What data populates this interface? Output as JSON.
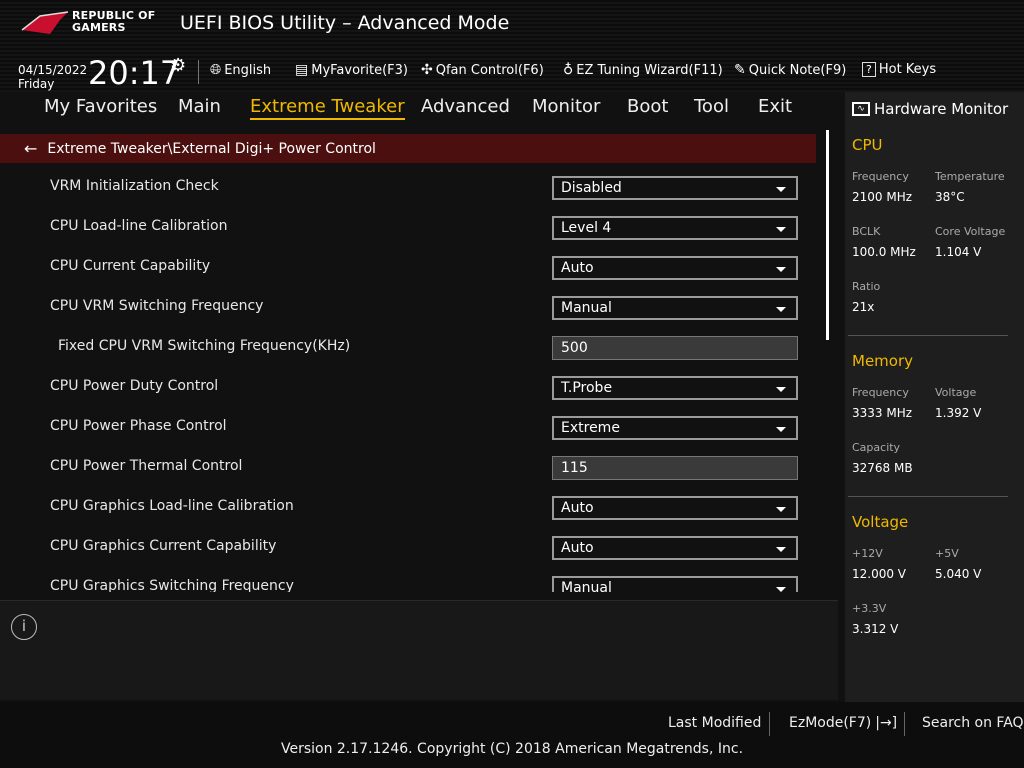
{
  "header": {
    "logo_text": [
      "REPUBLIC OF",
      "GAMERS"
    ],
    "title": "UEFI BIOS Utility – Advanced Mode",
    "date": "04/15/2022",
    "day": "Friday",
    "time": "20:17",
    "tools": [
      {
        "icon": "globe-icon",
        "label": "English"
      },
      {
        "icon": "favorite-list-icon",
        "label": "MyFavorite(F3)"
      },
      {
        "icon": "fan-icon",
        "label": "Qfan Control(F6)"
      },
      {
        "icon": "lightbulb-icon",
        "label": "EZ Tuning Wizard(F11)"
      },
      {
        "icon": "note-icon",
        "label": "Quick Note(F9)"
      },
      {
        "icon": "help-icon",
        "label": "Hot Keys"
      }
    ]
  },
  "nav": {
    "tabs": [
      "My Favorites",
      "Main",
      "Extreme Tweaker",
      "Advanced",
      "Monitor",
      "Boot",
      "Tool",
      "Exit"
    ],
    "active": "Extreme Tweaker"
  },
  "breadcrumb": "Extreme Tweaker\\External Digi+ Power Control",
  "settings": [
    {
      "label": "VRM Initialization Check",
      "value": "Disabled",
      "type": "select"
    },
    {
      "label": "CPU Load-line Calibration",
      "value": "Level 4",
      "type": "select"
    },
    {
      "label": "CPU Current Capability",
      "value": "Auto",
      "type": "select"
    },
    {
      "label": "CPU VRM Switching Frequency",
      "value": "Manual",
      "type": "select"
    },
    {
      "label": "Fixed CPU VRM Switching Frequency(KHz)",
      "value": "500",
      "type": "input"
    },
    {
      "label": "CPU Power Duty Control",
      "value": "T.Probe",
      "type": "select"
    },
    {
      "label": "CPU Power Phase Control",
      "value": "Extreme",
      "type": "select"
    },
    {
      "label": "CPU Power Thermal Control",
      "value": "115",
      "type": "input"
    },
    {
      "label": "CPU Graphics Load-line Calibration",
      "value": "Auto",
      "type": "select"
    },
    {
      "label": "CPU Graphics Current Capability",
      "value": "Auto",
      "type": "select"
    },
    {
      "label": "CPU Graphics Switching Frequency",
      "value": "Manual",
      "type": "select"
    }
  ],
  "hw": {
    "title": "Hardware Monitor",
    "cpu": {
      "title": "CPU",
      "freq_k": "Frequency",
      "freq": "2100 MHz",
      "temp_k": "Temperature",
      "temp": "38°C",
      "bclk_k": "BCLK",
      "bclk": "100.0 MHz",
      "cv_k": "Core Voltage",
      "cv": "1.104 V",
      "ratio_k": "Ratio",
      "ratio": "21x"
    },
    "mem": {
      "title": "Memory",
      "freq_k": "Frequency",
      "freq": "3333 MHz",
      "volt_k": "Voltage",
      "volt": "1.392 V",
      "cap_k": "Capacity",
      "cap": "32768 MB"
    },
    "volt": {
      "title": "Voltage",
      "v12_k": "+12V",
      "v12": "12.000 V",
      "v5_k": "+5V",
      "v5": "5.040 V",
      "v33_k": "+3.3V",
      "v33": "3.312 V"
    }
  },
  "footer": {
    "last_modified": "Last Modified",
    "ezmode": "EzMode(F7)",
    "search_faq": "Search on FAQ",
    "version": "Version 2.17.1246. Copyright (C) 2018 American Megatrends, Inc."
  },
  "colors": {
    "accent": "#f0b800",
    "breadcrumb_bg": "#4b0f0f"
  }
}
